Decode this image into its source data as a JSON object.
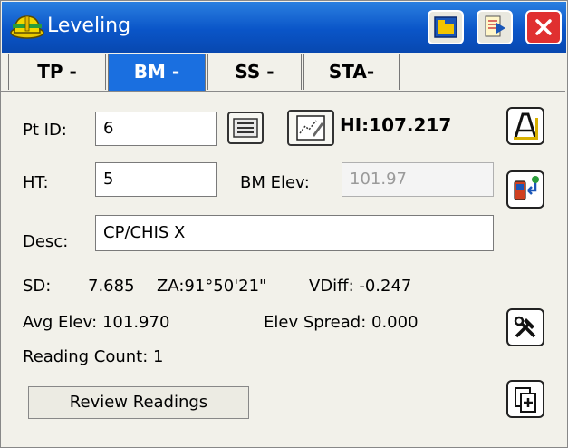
{
  "window": {
    "title": "Leveling"
  },
  "tabs": [
    {
      "label": "TP -",
      "active": false
    },
    {
      "label": "BM -",
      "active": true
    },
    {
      "label": "SS -",
      "active": false
    },
    {
      "label": "STA-",
      "active": false
    }
  ],
  "form": {
    "pt_id_label": "Pt ID:",
    "pt_id_value": "6",
    "hi_text": "HI:107.217",
    "ht_label": "HT:",
    "ht_value": "5",
    "bm_elev_label": "BM Elev:",
    "bm_elev_value": "101.97",
    "desc_label": "Desc:",
    "desc_value": "CP/CHIS X"
  },
  "readings": {
    "sd_label": "SD:",
    "sd_value": "7.685",
    "za_text": "ZA:91°50'21\"",
    "vdiff_text": "VDiff: -0.247",
    "avg_elev_text": "Avg Elev: 101.970",
    "elev_spread_text": "Elev Spread: 0.000",
    "reading_count_text": "Reading Count: 1"
  },
  "buttons": {
    "review_readings": "Review Readings"
  },
  "colors": {
    "titlebar": "#0a55c8",
    "active_tab": "#1a6fe0",
    "close": "#e03030",
    "background": "#f2f1ea"
  },
  "icons": {
    "app": "hardhat-icon",
    "titlebar_buttons": [
      "map-folder-icon",
      "notes-arrow-icon",
      "close-icon"
    ],
    "row_buttons": [
      "list-icon",
      "map-edit-icon"
    ],
    "side_buttons": [
      "level-instrument-icon",
      "device-connect-icon",
      "tools-icon",
      "copy-add-icon"
    ]
  }
}
